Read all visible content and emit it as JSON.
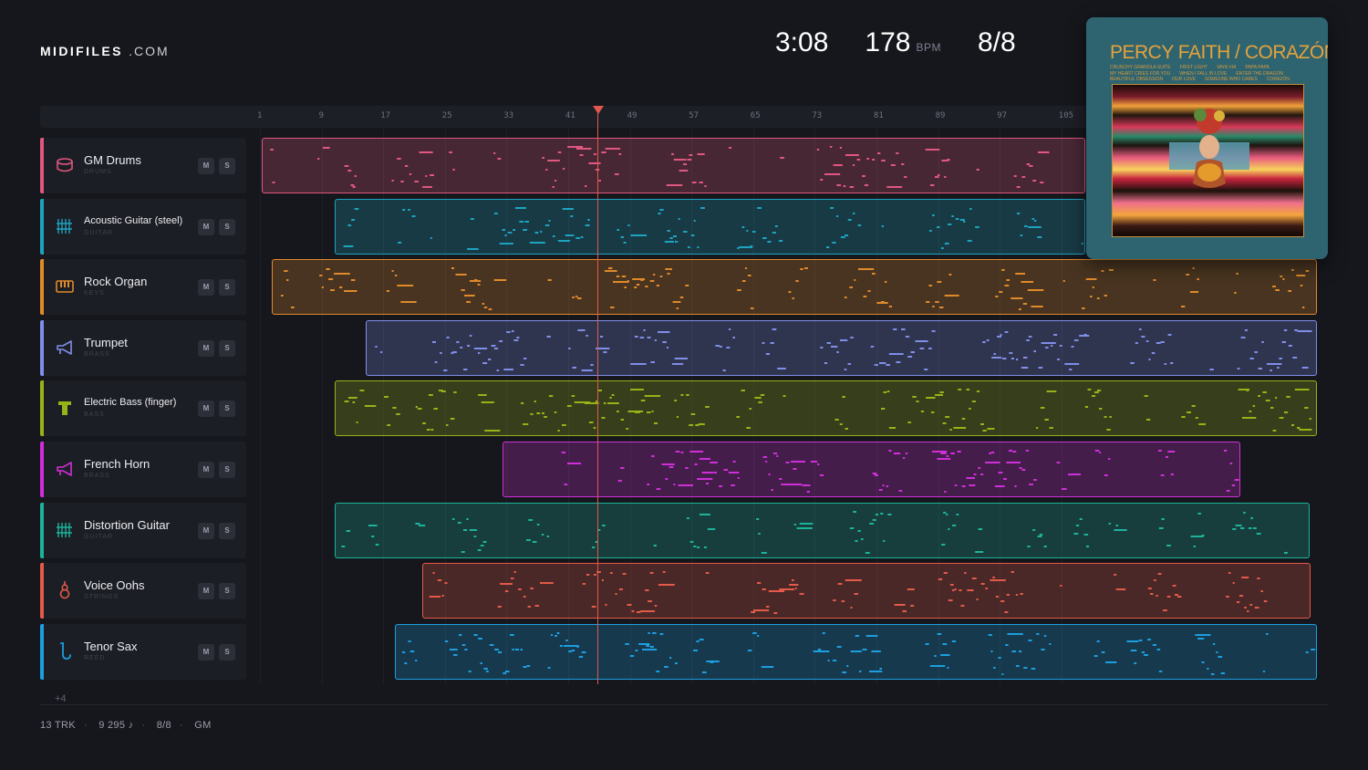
{
  "brand": {
    "name_bold": "MIDIFILES",
    "name_rest": ".COM"
  },
  "header": {
    "duration": "3:08",
    "tempo": "178",
    "tempo_unit": "BPM",
    "time_signature": "8/8"
  },
  "ruler": {
    "bars": [
      "1",
      "9",
      "17",
      "25",
      "33",
      "41",
      "49",
      "57",
      "65",
      "73",
      "81",
      "89",
      "97",
      "105"
    ]
  },
  "playhead": {
    "label": "playhead"
  },
  "tracks": [
    {
      "name": "GM Drums",
      "category": "DRUMS",
      "color": "#e0577f",
      "icon": "drum-icon",
      "mute": "M",
      "solo": "S"
    },
    {
      "name": "Acoustic Guitar (steel)",
      "category": "GUITAR",
      "color": "#1ea3bf",
      "icon": "guitar-grid-icon",
      "mute": "M",
      "solo": "S"
    },
    {
      "name": "Rock Organ",
      "category": "KEYS",
      "color": "#e08a2a",
      "icon": "keyboard-icon",
      "mute": "M",
      "solo": "S"
    },
    {
      "name": "Trumpet",
      "category": "BRASS",
      "color": "#7f8ee8",
      "icon": "horn-icon",
      "mute": "M",
      "solo": "S"
    },
    {
      "name": "Electric Bass (finger)",
      "category": "BASS",
      "color": "#98b318",
      "icon": "bass-icon",
      "mute": "M",
      "solo": "S"
    },
    {
      "name": "French Horn",
      "category": "BRASS",
      "color": "#cf2fd9",
      "icon": "horn-icon",
      "mute": "M",
      "solo": "S"
    },
    {
      "name": "Distortion Guitar",
      "category": "GUITAR",
      "color": "#1db39b",
      "icon": "guitar-grid-icon",
      "mute": "M",
      "solo": "S"
    },
    {
      "name": "Voice Oohs",
      "category": "STRINGS",
      "color": "#e35a48",
      "icon": "violin-icon",
      "mute": "M",
      "solo": "S"
    },
    {
      "name": "Tenor Sax",
      "category": "REED",
      "color": "#1c9ee0",
      "icon": "sax-icon",
      "mute": "M",
      "solo": "S"
    }
  ],
  "more_tracks": "+4",
  "footer": {
    "tracks": "13 TRK",
    "notes": "9 295 ♪",
    "meter": "8/8",
    "standard": "GM"
  },
  "album": {
    "title": "PERCY FAITH / CORAZÓN",
    "songs": [
      "CRUNCHY GRANOLA SUITE",
      "FIRST LIGHT",
      "VAYA VIA",
      "PAPA PAPA",
      "MY HEART CRIES FOR YOU",
      "WHEN I FALL IN LOVE",
      "ENTER THE DRAGON",
      "BEAUTIFUL OBSESSION",
      "OUR LOVE",
      "SOMEONE WHO CARES",
      "CORAZÓN"
    ]
  }
}
